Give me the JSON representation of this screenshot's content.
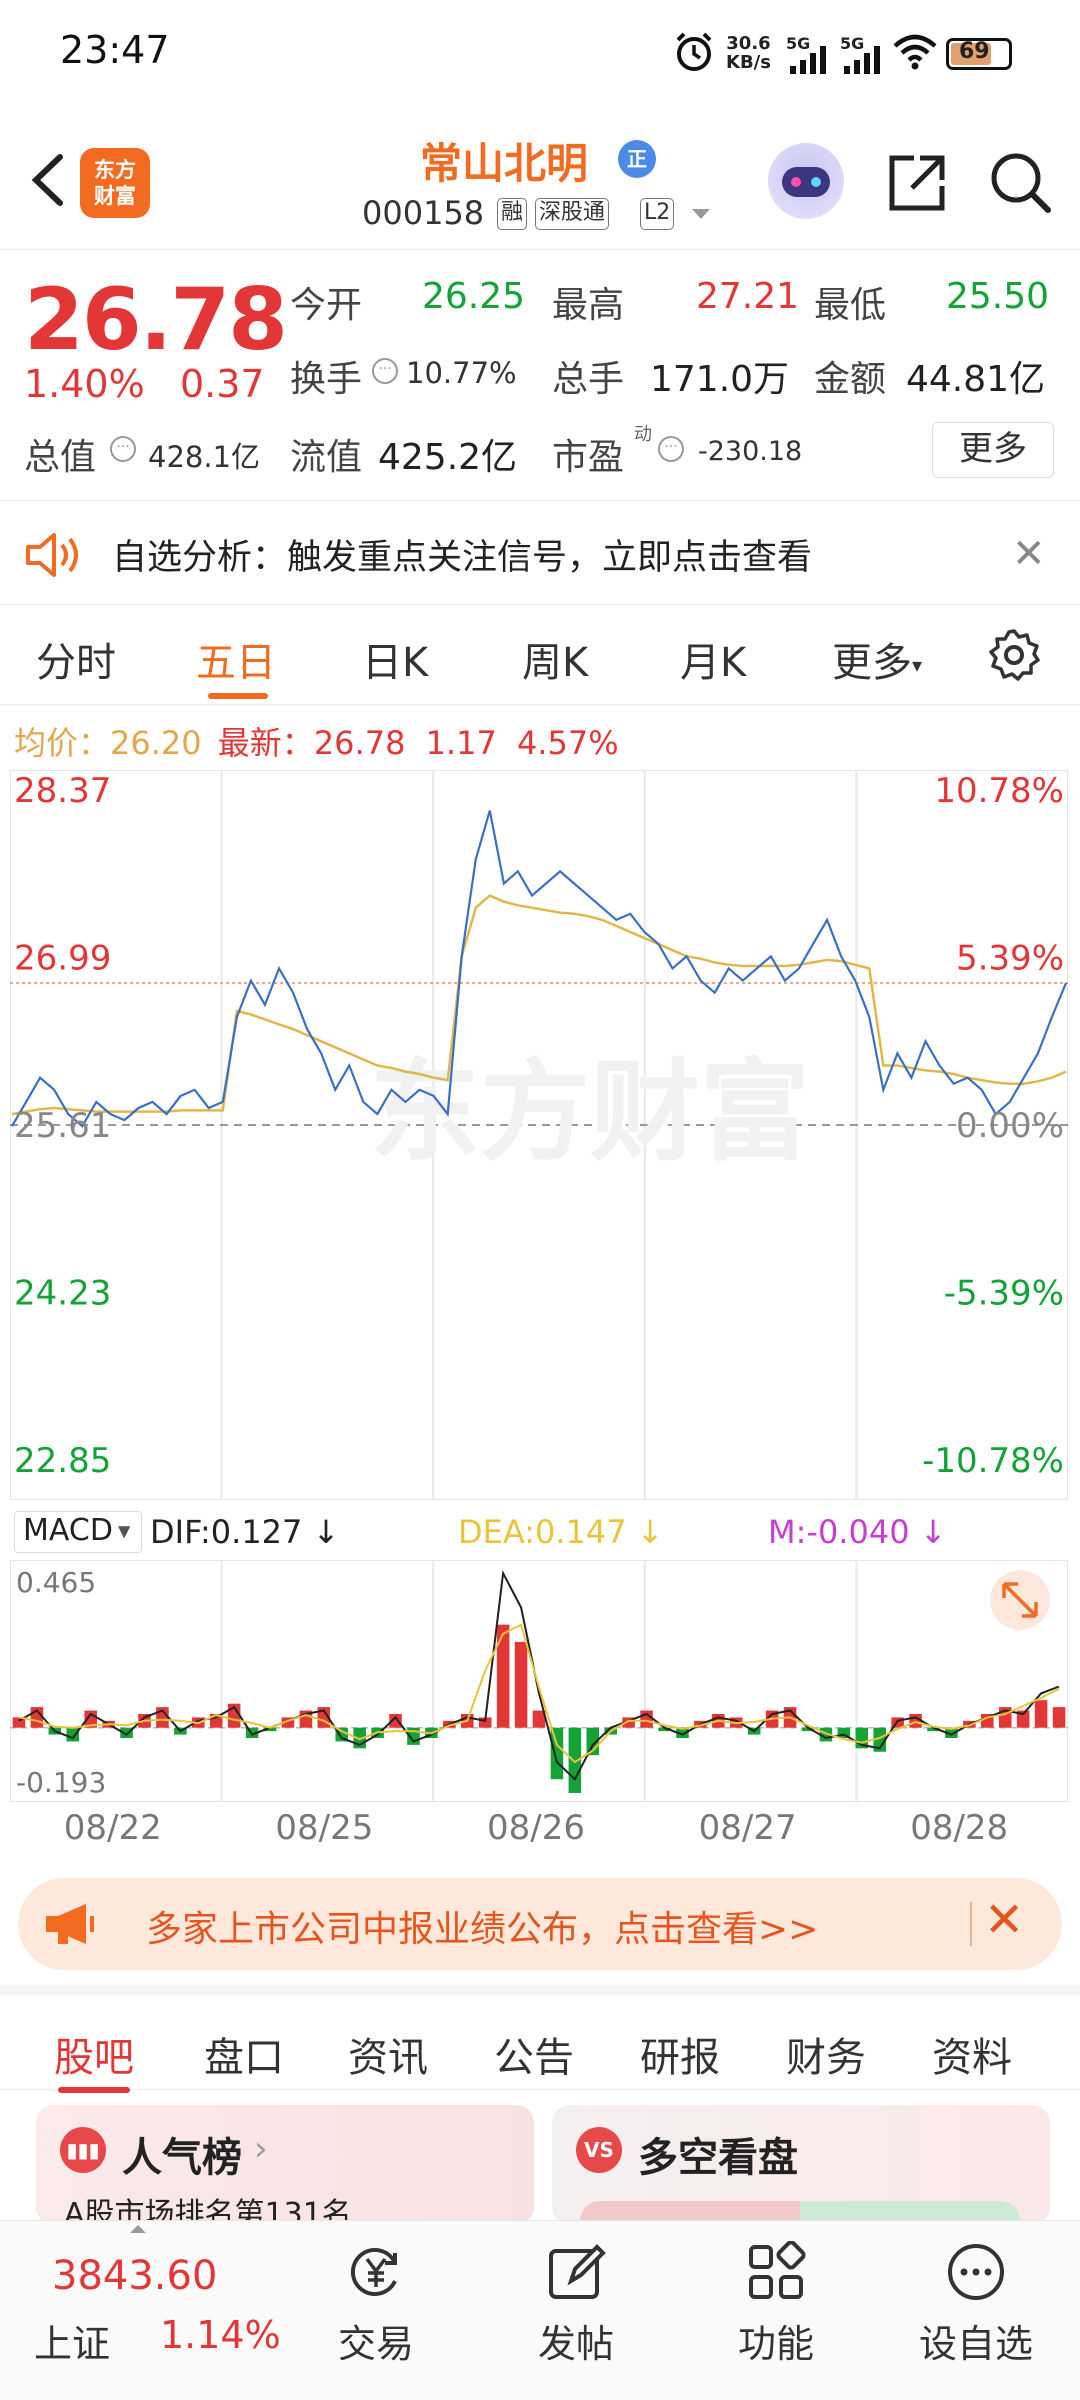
{
  "status_bar": {
    "time": "23:47",
    "net_speed_value": "30.6",
    "net_speed_unit": "KB/s",
    "sim1": "5G",
    "sim2": "5G",
    "battery": "69"
  },
  "header": {
    "stock_name": "常山北明",
    "stock_tag": "正",
    "stock_code": "000158",
    "tags": [
      "融",
      "深股通",
      "L2"
    ],
    "brand": [
      "东方",
      "财富"
    ]
  },
  "quote": {
    "price": "26.78",
    "pct_change": "1.40%",
    "abs_change": "0.37",
    "open_label": "今开",
    "open": "26.25",
    "high_label": "最高",
    "high": "27.21",
    "low_label": "最低",
    "low": "25.50",
    "turnover_label": "换手",
    "turnover": "10.77%",
    "volume_label": "总手",
    "volume": "171.0万",
    "amount_label": "金额",
    "amount": "44.81亿",
    "mktcap_label": "总值",
    "mktcap": "428.1亿",
    "float_label": "流值",
    "float_cap": "425.2亿",
    "pe_label": "市盈",
    "pe_sup": "动",
    "pe": "-230.18",
    "more_label": "更多"
  },
  "notice": {
    "text": "自选分析：触发重点关注信号，立即点击查看"
  },
  "chart_tabs": [
    "分时",
    "五日",
    "日K",
    "周K",
    "月K",
    "更多"
  ],
  "avg_line": {
    "avg_label": "均价：",
    "avg": "26.20",
    "latest_label": "最新：",
    "latest": "26.78",
    "change": "1.17",
    "change_pct": "4.57%"
  },
  "watermark": "东方财富",
  "macd": {
    "selector": "MACD",
    "dif": "DIF:0.127 ↓",
    "dea": "DEA:0.147 ↓",
    "m": "M:-0.040 ↓",
    "max": "0.465",
    "min": "-0.193"
  },
  "chart_data": [
    {
      "type": "line",
      "title": "",
      "x": [
        "08/22",
        "08/25",
        "08/26",
        "08/27",
        "08/28"
      ],
      "ylim": [
        22.85,
        28.37
      ],
      "y_ticks_left": [
        "28.37",
        "26.99",
        "25.61",
        "24.23",
        "22.85"
      ],
      "y_ticks_right": [
        "10.78%",
        "5.39%",
        "0.00%",
        "-5.39%",
        "-10.78%"
      ],
      "prev_close": 25.61,
      "series": [
        {
          "color": "#3a6fc4",
          "values": [
            25.6,
            25.8,
            26.0,
            25.9,
            25.7,
            25.6,
            25.8,
            25.7,
            25.65,
            25.75,
            25.8,
            25.7,
            25.85,
            25.9,
            25.75,
            25.8,
            26.5,
            26.8,
            26.6,
            26.9,
            26.7,
            26.4,
            26.2,
            25.9,
            26.1,
            25.8,
            25.7,
            25.9,
            25.8,
            25.9,
            25.85,
            25.7,
            27.0,
            27.8,
            28.2,
            27.6,
            27.7,
            27.5,
            27.6,
            27.7,
            27.6,
            27.5,
            27.4,
            27.3,
            27.35,
            27.2,
            27.1,
            26.9,
            27.0,
            26.8,
            26.7,
            26.9,
            26.8,
            26.9,
            27.0,
            26.8,
            26.9,
            27.1,
            27.3,
            27.0,
            26.8,
            26.5,
            25.9,
            26.2,
            26.0,
            26.3,
            26.1,
            25.95,
            26.0,
            25.9,
            25.7,
            25.8,
            26.0,
            26.2,
            26.5,
            26.78
          ]
        },
        {
          "color": "#e0b84a",
          "values": [
            25.7,
            25.72,
            25.74,
            25.75,
            25.74,
            25.73,
            25.72,
            25.72,
            25.72,
            25.72,
            25.72,
            25.72,
            25.73,
            25.73,
            25.73,
            25.73,
            26.55,
            26.52,
            26.48,
            26.44,
            26.4,
            26.35,
            26.3,
            26.25,
            26.2,
            26.15,
            26.1,
            26.08,
            26.05,
            26.03,
            26.0,
            25.98,
            27.0,
            27.4,
            27.5,
            27.45,
            27.42,
            27.4,
            27.38,
            27.36,
            27.35,
            27.33,
            27.3,
            27.25,
            27.2,
            27.15,
            27.1,
            27.05,
            27.0,
            26.98,
            26.95,
            26.93,
            26.92,
            26.92,
            26.92,
            26.92,
            26.93,
            26.95,
            26.97,
            26.96,
            26.93,
            26.9,
            26.1,
            26.1,
            26.08,
            26.06,
            26.05,
            26.03,
            26.0,
            25.98,
            25.96,
            25.95,
            25.95,
            25.97,
            26.0,
            26.05
          ]
        }
      ]
    },
    {
      "type": "bar",
      "title": "",
      "ylim": [
        -0.193,
        0.465
      ],
      "x": [
        "08/22",
        "08/25",
        "08/26",
        "08/27",
        "08/28"
      ],
      "series": [
        {
          "name": "DIF",
          "values": [
            0.02,
            0.05,
            -0.01,
            -0.03,
            0.04,
            0.01,
            -0.02,
            0.03,
            0.05,
            -0.01,
            0.02,
            0.03,
            0.06,
            -0.02,
            0.0,
            0.02,
            0.04,
            0.05,
            -0.03,
            -0.05,
            -0.02,
            0.03,
            -0.04,
            -0.02,
            0.01,
            0.03,
            0.02,
            0.45,
            0.35,
            0.1,
            -0.1,
            -0.15,
            -0.05,
            0.0,
            0.02,
            0.04,
            0.0,
            -0.02,
            0.01,
            0.03,
            0.02,
            -0.01,
            0.04,
            0.05,
            0.0,
            -0.03,
            -0.02,
            -0.05,
            -0.06,
            0.02,
            0.03,
            0.0,
            -0.02,
            0.01,
            0.03,
            0.05,
            0.04,
            0.1,
            0.12
          ]
        },
        {
          "name": "MACD",
          "values": [
            0.03,
            0.06,
            -0.02,
            -0.04,
            0.05,
            0.02,
            -0.03,
            0.04,
            0.06,
            -0.02,
            0.03,
            0.04,
            0.07,
            -0.03,
            -0.01,
            0.03,
            0.05,
            0.06,
            -0.04,
            -0.06,
            -0.03,
            0.04,
            -0.05,
            -0.03,
            0.02,
            0.04,
            0.03,
            0.3,
            0.25,
            0.05,
            -0.15,
            -0.19,
            -0.08,
            -0.02,
            0.03,
            0.05,
            -0.01,
            -0.03,
            0.02,
            0.04,
            0.03,
            -0.02,
            0.05,
            0.06,
            -0.01,
            -0.04,
            -0.03,
            -0.06,
            -0.07,
            0.03,
            0.04,
            -0.01,
            -0.03,
            0.02,
            0.04,
            0.06,
            0.05,
            0.08,
            0.06
          ]
        }
      ]
    }
  ],
  "promo": {
    "text": "多家上市公司中报业绩公布，点击查看>>"
  },
  "section_tabs": [
    "股吧",
    "盘口",
    "资讯",
    "公告",
    "研报",
    "财务",
    "资料"
  ],
  "cards": {
    "popular_title": "人气榜",
    "popular_sub": "A股市场排名第131名",
    "longshort_title": "多空看盘",
    "vs": "VS"
  },
  "bottom_nav": {
    "index_value": "3843.60",
    "index_name": "上证",
    "index_pct": "1.14%",
    "items": [
      "交易",
      "发帖",
      "功能",
      "设自选"
    ]
  }
}
